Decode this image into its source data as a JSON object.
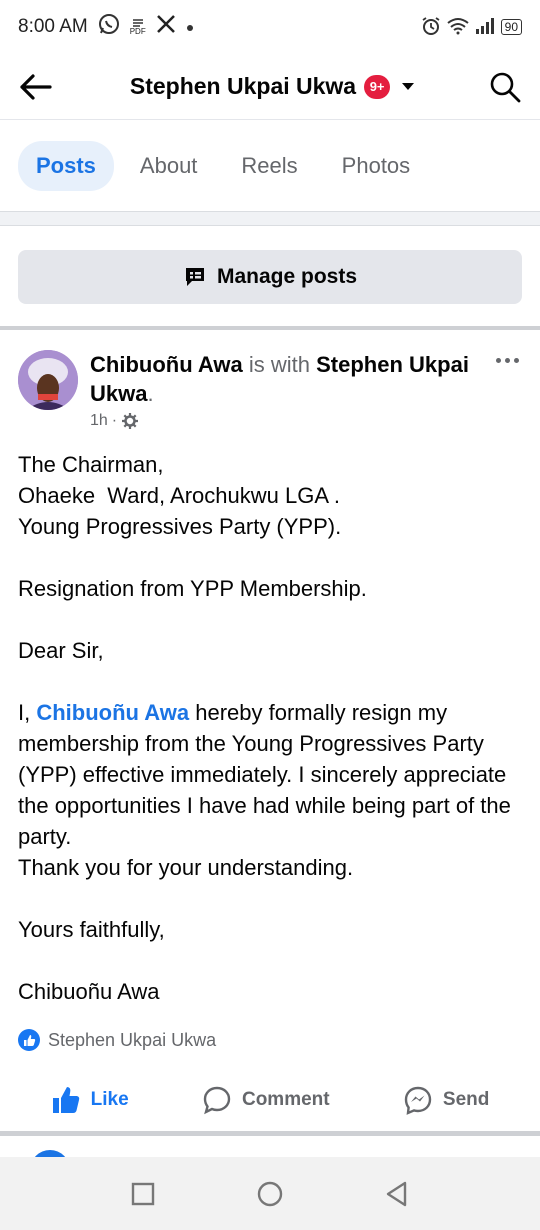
{
  "status_bar": {
    "time": "8:00 AM",
    "icons": [
      "whatsapp-icon",
      "pdf-icon",
      "x-icon",
      "dot-icon",
      "alarm-icon",
      "wifi-icon",
      "signal-icon",
      "battery-icon"
    ],
    "pdf_label": "PDF",
    "battery": "90"
  },
  "header": {
    "title": "Stephen Ukpai Ukwa",
    "badge": "9+"
  },
  "tabs": [
    {
      "label": "Posts",
      "active": true
    },
    {
      "label": "About",
      "active": false
    },
    {
      "label": "Reels",
      "active": false
    },
    {
      "label": "Photos",
      "active": false
    }
  ],
  "manage_posts": {
    "label": "Manage posts"
  },
  "post": {
    "author": "Chibuoñu Awa",
    "with_text": " is with ",
    "tagged": "Stephen Ukpai Ukwa",
    "period": ".",
    "time": "1h",
    "dot": "·",
    "lines": [
      "The Chairman,",
      "Ohaeke  Ward, Arochukwu LGA .",
      "Young Progressives Party (YPP).",
      "Resignation from YPP Membership.",
      "Dear Sir,",
      "Thank you for your understanding.",
      "Yours faithfully,",
      "Chibuoñu Awa"
    ],
    "para_prefix": "I, ",
    "para_mention": "Chibuoñu Awa",
    "para_rest": " hereby formally resign my membership from the Young Progressives Party (YPP) effective immediately. I sincerely appreciate the opportunities I have had while being part of the party.",
    "reaction_name": "Stephen Ukpai Ukwa"
  },
  "actions": {
    "like": "Like",
    "comment": "Comment",
    "send": "Send"
  },
  "colors": {
    "accent": "#1b74e4",
    "badge": "#e41e3f",
    "muted": "#65676b"
  }
}
